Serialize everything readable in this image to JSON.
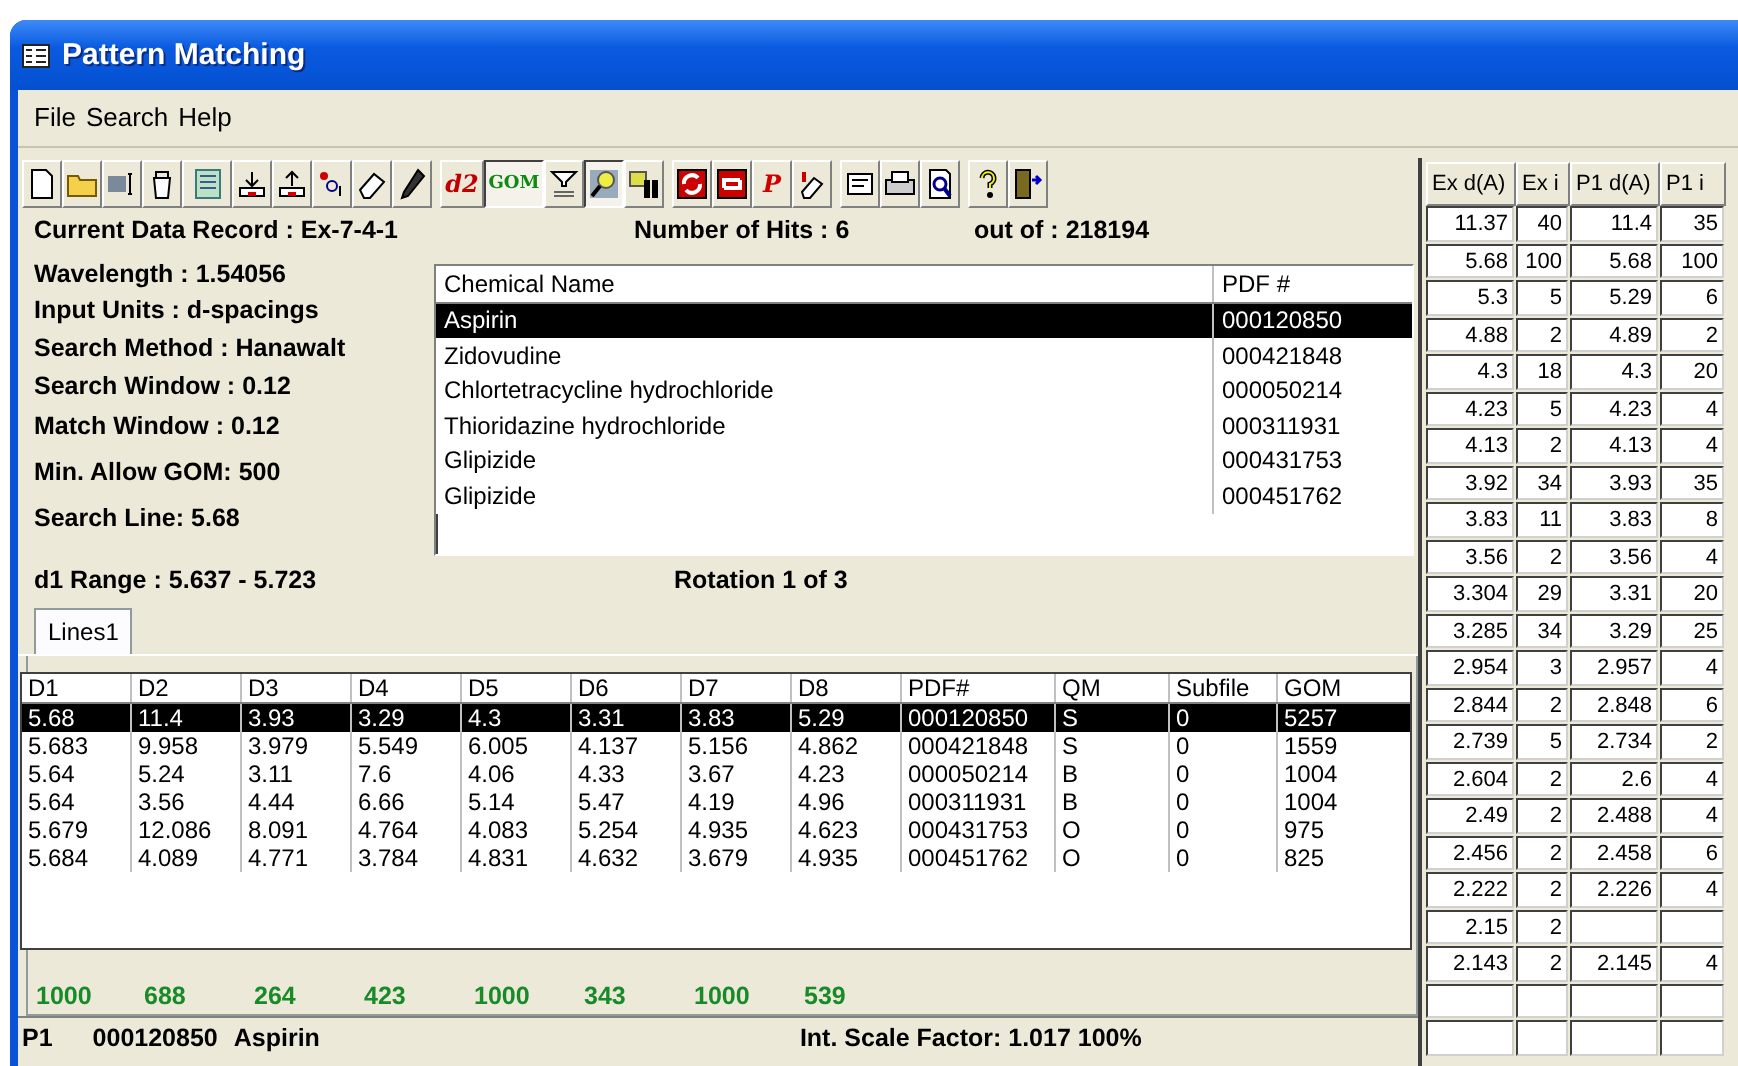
{
  "window": {
    "title": "Pattern Matching"
  },
  "menu": [
    "File",
    "Search",
    "Help"
  ],
  "toolbar": {
    "labels": [
      "d2",
      "GOM",
      "P"
    ]
  },
  "info": {
    "current_record": {
      "label": "Current Data Record :",
      "value": "Ex-7-4-1"
    },
    "hits": {
      "label": "Number of Hits :",
      "value": "6"
    },
    "out_of": {
      "label": "out of :",
      "value": "218194"
    }
  },
  "params": [
    {
      "label": "Wavelength :",
      "value": "1.54056"
    },
    {
      "label": "Input Units :",
      "value": "d-spacings"
    },
    {
      "label": "Search Method :",
      "value": "Hanawalt"
    },
    {
      "label": "Search Window :",
      "value": "0.12"
    },
    {
      "label": "Match Window :",
      "value": "0.12"
    },
    {
      "label": "Min. Allow GOM:",
      "value": "500"
    },
    {
      "label": "Search Line:",
      "value": "5.68"
    }
  ],
  "d1_range": {
    "label": "d1 Range :",
    "value": "5.637 - 5.723"
  },
  "rotation": "Rotation  1 of 3",
  "hit_list": {
    "columns": [
      "Chemical Name",
      "PDF #"
    ],
    "rows": [
      {
        "name": "Aspirin",
        "pdf": "000120850",
        "selected": true
      },
      {
        "name": "Zidovudine",
        "pdf": "000421848",
        "selected": false
      },
      {
        "name": "Chlortetracycline hydrochloride",
        "pdf": "000050214",
        "selected": false
      },
      {
        "name": "Thioridazine hydrochloride",
        "pdf": "000311931",
        "selected": false
      },
      {
        "name": "Glipizide",
        "pdf": "000431753",
        "selected": false
      },
      {
        "name": "Glipizide",
        "pdf": "000451762",
        "selected": false
      }
    ]
  },
  "tabs": [
    {
      "label": "Lines1",
      "selected": true
    }
  ],
  "lines_table": {
    "columns": [
      "D1",
      "D2",
      "D3",
      "D4",
      "D5",
      "D6",
      "D7",
      "D8",
      "PDF#",
      "QM",
      "Subfile",
      "GOM"
    ],
    "rows": [
      {
        "cells": [
          "5.68",
          "11.4",
          "3.93",
          "3.29",
          "4.3",
          "3.31",
          "3.83",
          "5.29",
          "000120850",
          "S",
          "0",
          "5257"
        ],
        "selected": true
      },
      {
        "cells": [
          "5.683",
          "9.958",
          "3.979",
          "5.549",
          "6.005",
          "4.137",
          "5.156",
          "4.862",
          "000421848",
          "S",
          "0",
          "1559"
        ],
        "selected": false
      },
      {
        "cells": [
          "5.64",
          "5.24",
          "3.11",
          "7.6",
          "4.06",
          "4.33",
          "3.67",
          "4.23",
          "000050214",
          "B",
          "0",
          "1004"
        ],
        "selected": false
      },
      {
        "cells": [
          "5.64",
          "3.56",
          "4.44",
          "6.66",
          "5.14",
          "5.47",
          "4.19",
          "4.96",
          "000311931",
          "B",
          "0",
          "1004"
        ],
        "selected": false
      },
      {
        "cells": [
          "5.679",
          "12.086",
          "8.091",
          "4.764",
          "4.083",
          "5.254",
          "4.935",
          "4.623",
          "000431753",
          "O",
          "0",
          "975"
        ],
        "selected": false
      },
      {
        "cells": [
          "5.684",
          "4.089",
          "4.771",
          "3.784",
          "4.831",
          "4.632",
          "3.679",
          "4.935",
          "000451762",
          "O",
          "0",
          "825"
        ],
        "selected": false
      }
    ],
    "totals": [
      "1000",
      "688",
      "264",
      "423",
      "1000",
      "343",
      "1000",
      "539"
    ]
  },
  "status_bar": {
    "pattern": "P1",
    "pdf": "000120850",
    "name": "Aspirin",
    "scale": "Int. Scale Factor: 1.017  100%"
  },
  "peak_grid": {
    "columns": [
      "Ex d(A)",
      "Ex i",
      "P1 d(A)",
      "P1 i"
    ],
    "rows": [
      [
        "11.37",
        "40",
        "11.4",
        "35"
      ],
      [
        "5.68",
        "100",
        "5.68",
        "100"
      ],
      [
        "5.3",
        "5",
        "5.29",
        "6"
      ],
      [
        "4.88",
        "2",
        "4.89",
        "2"
      ],
      [
        "4.3",
        "18",
        "4.3",
        "20"
      ],
      [
        "4.23",
        "5",
        "4.23",
        "4"
      ],
      [
        "4.13",
        "2",
        "4.13",
        "4"
      ],
      [
        "3.92",
        "34",
        "3.93",
        "35"
      ],
      [
        "3.83",
        "11",
        "3.83",
        "8"
      ],
      [
        "3.56",
        "2",
        "3.56",
        "4"
      ],
      [
        "3.304",
        "29",
        "3.31",
        "20"
      ],
      [
        "3.285",
        "34",
        "3.29",
        "25"
      ],
      [
        "2.954",
        "3",
        "2.957",
        "4"
      ],
      [
        "2.844",
        "2",
        "2.848",
        "6"
      ],
      [
        "2.739",
        "5",
        "2.734",
        "2"
      ],
      [
        "2.604",
        "2",
        "2.6",
        "4"
      ],
      [
        "2.49",
        "2",
        "2.488",
        "4"
      ],
      [
        "2.456",
        "2",
        "2.458",
        "6"
      ],
      [
        "2.222",
        "2",
        "2.226",
        "4"
      ],
      [
        "2.15",
        "2"
      ],
      [
        "2.143",
        "2",
        "2.145",
        "4"
      ]
    ]
  }
}
